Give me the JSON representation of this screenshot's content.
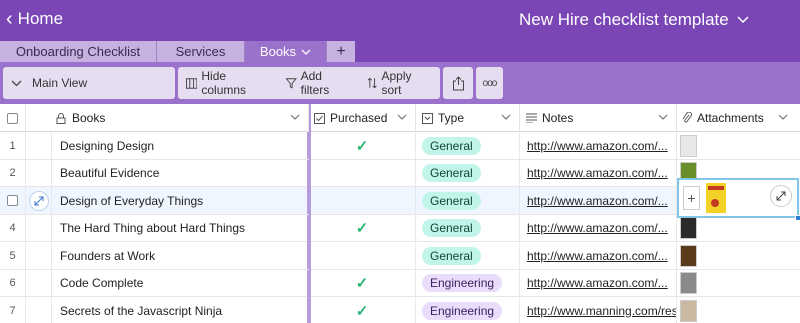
{
  "app": {
    "home_label": "Home",
    "base_title": "New Hire checklist template"
  },
  "tabs": [
    {
      "label": "Onboarding Checklist"
    },
    {
      "label": "Services"
    },
    {
      "label": "Books"
    }
  ],
  "toolbar": {
    "view_name": "Main View",
    "hide_columns": "Hide columns",
    "add_filters": "Add filters",
    "apply_sort": "Apply sort",
    "more": "ooo"
  },
  "columns": {
    "books": "Books",
    "purchased": "Purchased",
    "type": "Type",
    "notes": "Notes",
    "attachments": "Attachments"
  },
  "rows": [
    {
      "num": "1",
      "name": "Designing Design",
      "purchased": "✓",
      "type": "General",
      "type_class": "general",
      "notes": "http://www.amazon.com/...",
      "thumb_color": "#e8e8e8"
    },
    {
      "num": "2",
      "name": "Beautiful Evidence",
      "purchased": "",
      "type": "General",
      "type_class": "general",
      "notes": "http://www.amazon.com/...",
      "thumb_color": "#6a8f2a"
    },
    {
      "num": "3",
      "name": "Design of Everyday Things",
      "purchased": "",
      "type": "General",
      "type_class": "general",
      "notes": "http://www.amazon.com/...",
      "thumb_color": "#f2d227"
    },
    {
      "num": "4",
      "name": "The Hard Thing about Hard Things",
      "purchased": "✓",
      "type": "General",
      "type_class": "general",
      "notes": "http://www.amazon.com/...",
      "thumb_color": "#2a2a2a"
    },
    {
      "num": "5",
      "name": "Founders at Work",
      "purchased": "",
      "type": "General",
      "type_class": "general",
      "notes": "http://www.amazon.com/...",
      "thumb_color": "#5a3a1a"
    },
    {
      "num": "6",
      "name": "Code Complete",
      "purchased": "✓",
      "type": "Engineering",
      "type_class": "engineering",
      "notes": "http://www.amazon.com/...",
      "thumb_color": "#8a8a8a"
    },
    {
      "num": "7",
      "name": "Secrets of the Javascript Ninja",
      "purchased": "✓",
      "type": "Engineering",
      "type_class": "engineering",
      "notes": "http://www.manning.com/res",
      "thumb_color": "#c8b9a0"
    }
  ],
  "colors": {
    "primary": "#7a45b5",
    "view_bar": "#9a71cb",
    "check": "#2bb673"
  }
}
